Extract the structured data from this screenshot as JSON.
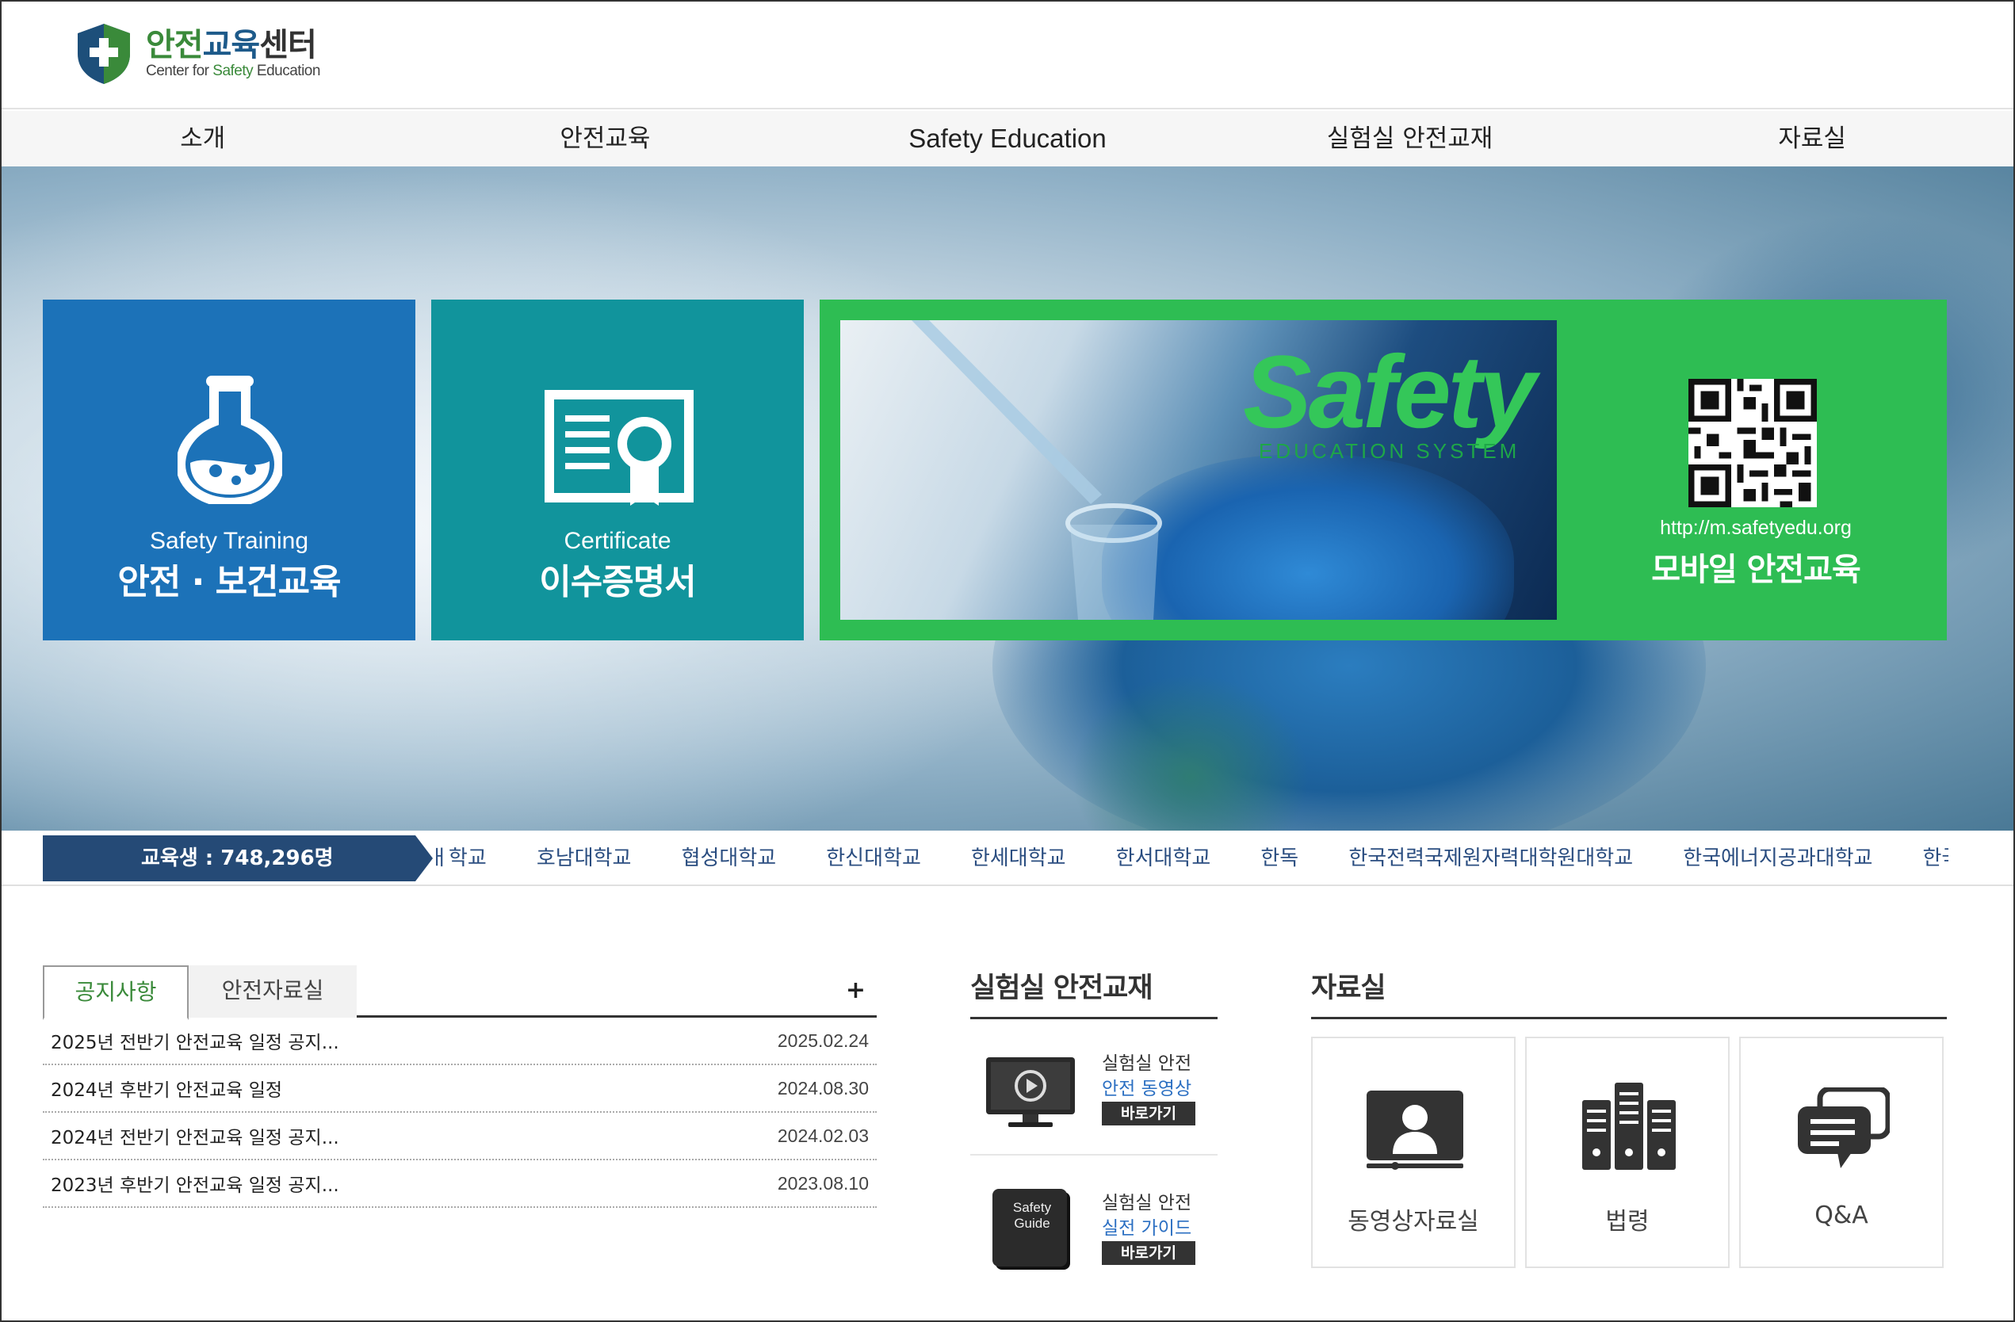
{
  "header": {
    "logo_ko_part1": "안전",
    "logo_ko_part2": "교육",
    "logo_ko_part3": "센터",
    "logo_en_part1": "Center for ",
    "logo_en_part2": "Safety",
    "logo_en_part3": " Education"
  },
  "nav": {
    "items": [
      "소개",
      "안전교육",
      "Safety Education",
      "실험실 안전교재",
      "자료실"
    ]
  },
  "hero": {
    "training": {
      "en": "Safety Training",
      "ko": "안전 · 보건교육"
    },
    "certificate": {
      "en": "Certificate",
      "ko": "이수증명서"
    },
    "mobile": {
      "logo_word": "Safety",
      "logo_sub": "EDUCATION SYSTEM",
      "url": "http://m.safetyedu.org",
      "ko": "모바일 안전교육"
    }
  },
  "ticker": {
    "student_count": "교육생 : 748,296명",
    "universities": [
      "ㅐ학교",
      "호남대학교",
      "협성대학교",
      "한신대학교",
      "한세대학교",
      "한서대학교",
      "한독",
      "한국전력국제원자력대학원대학교",
      "한국에너지공과대학교",
      "한국"
    ]
  },
  "notice": {
    "tabs": [
      "공지사항",
      "안전자료실"
    ],
    "more": "+",
    "rows": [
      {
        "title": "2025년 전반기 안전교육 일정 공지...",
        "date": "2025.02.24"
      },
      {
        "title": "2024년 후반기 안전교육 일정",
        "date": "2024.08.30"
      },
      {
        "title": "2024년 전반기 안전교육 일정 공지...",
        "date": "2024.02.03"
      },
      {
        "title": "2023년 후반기 안전교육 일정 공지...",
        "date": "2023.08.10"
      }
    ]
  },
  "lab": {
    "title": "실험실 안전교재",
    "items": [
      {
        "line1": "실험실 안전",
        "line2": "안전 동영상",
        "go": "바로가기"
      },
      {
        "line1": "실험실 안전",
        "line2": "실전 가이드",
        "go": "바로가기",
        "book_label": "Safety Guide"
      }
    ]
  },
  "resources": {
    "title": "자료실",
    "items": [
      "동영상자료실",
      "법령",
      "Q&A"
    ]
  },
  "colors": {
    "training_tile": "#1c72b8",
    "certificate_tile": "#11949c",
    "mobile_tile": "#2ebd53",
    "ticker_badge": "#254a76",
    "accent_green": "#3a8a3a"
  }
}
